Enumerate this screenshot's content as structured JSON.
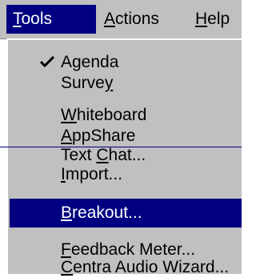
{
  "menubar": {
    "tools": {
      "label": "Tools",
      "underline": "T",
      "rest": "ools"
    },
    "actions": {
      "label": "Actions",
      "underline": "A",
      "rest": "ctions"
    },
    "help": {
      "label": "Help",
      "underline": "H",
      "rest": "elp"
    }
  },
  "tools_menu": {
    "items": [
      {
        "label": "Agenda",
        "checked": true
      },
      {
        "label": "Survey",
        "u_prefix": "Surve",
        "u_char": "y",
        "u_suffix": ""
      },
      {
        "label": "Whiteboard",
        "u_prefix": "",
        "u_char": "W",
        "u_suffix": "hiteboard"
      },
      {
        "label": "AppShare",
        "u_prefix": "",
        "u_char": "A",
        "u_suffix": "ppShare"
      },
      {
        "label": "Text Chat...",
        "u_prefix": "Text ",
        "u_char": "C",
        "u_suffix": "hat..."
      },
      {
        "label": "Import...",
        "u_prefix": "",
        "u_char": "I",
        "u_suffix": "mport..."
      },
      {
        "label": "Breakout...",
        "u_prefix": "",
        "u_char": "B",
        "u_suffix": "reakout..."
      },
      {
        "label": "Feedback Meter...",
        "u_prefix": "",
        "u_char": "F",
        "u_suffix": "eedback Meter..."
      },
      {
        "label": "Centra Audio Wizard...",
        "u_prefix": "",
        "u_char": "C",
        "u_suffix": "entra Audio Wizard..."
      }
    ]
  },
  "colors": {
    "highlight": "#000080",
    "menu_bg": "#c0c0c0"
  },
  "icons": {
    "check": "check-icon"
  }
}
